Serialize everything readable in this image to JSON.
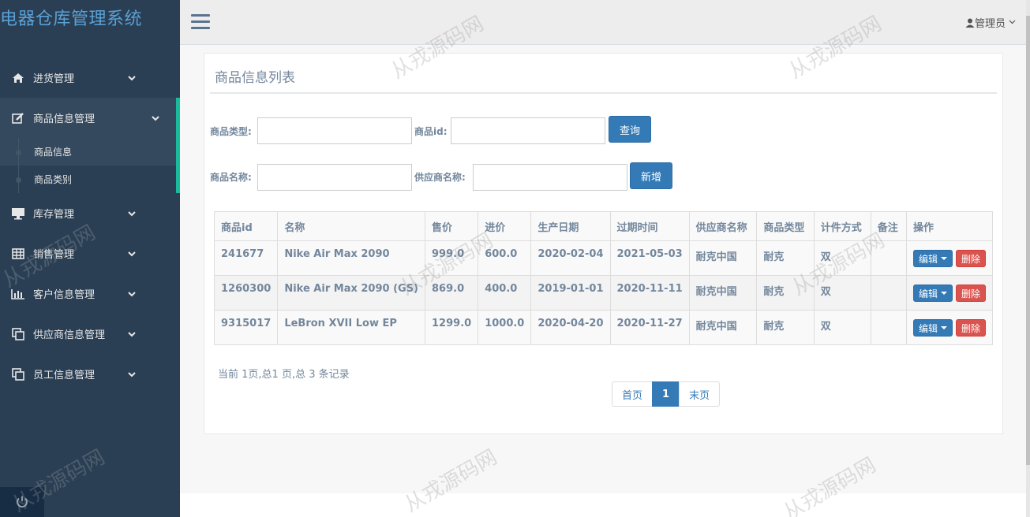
{
  "app": {
    "brand": "电器仓库管理系统"
  },
  "sidebar": {
    "items": [
      {
        "label": "进货管理",
        "icon": "home-icon"
      },
      {
        "label": "商品信息管理",
        "icon": "edit-icon"
      },
      {
        "label": "库存管理",
        "icon": "monitor-icon"
      },
      {
        "label": "销售管理",
        "icon": "table-icon"
      },
      {
        "label": "客户信息管理",
        "icon": "bar-chart-icon"
      },
      {
        "label": "供应商信息管理",
        "icon": "clone-icon"
      },
      {
        "label": "员工信息管理",
        "icon": "clone-icon"
      }
    ],
    "submenu": [
      {
        "label": "商品信息"
      },
      {
        "label": "商品类别"
      }
    ],
    "accent_color": "#1abb9c"
  },
  "topnav": {
    "user": "管理员"
  },
  "panel": {
    "title": "商品信息列表"
  },
  "filters": {
    "type_label": "商品类型:",
    "type_value": "",
    "id_label": "商品id:",
    "id_value": "",
    "query_button": "查询",
    "name_label": "商品名称:",
    "name_value": "",
    "supplier_label": "供应商名称:",
    "supplier_value": "",
    "add_button": "新增"
  },
  "table": {
    "headers": [
      "商品id",
      "名称",
      "售价",
      "进价",
      "生产日期",
      "过期时间",
      "供应商名称",
      "商品类型",
      "计件方式",
      "备注",
      "操作"
    ],
    "rows": [
      [
        "241677",
        "Nike Air Max 2090",
        "999.0",
        "600.0",
        "2020-02-04",
        "2021-05-03",
        "耐克中国",
        "耐克",
        "双",
        ""
      ],
      [
        "1260300",
        "Nike Air Max 2090 (GS)",
        "869.0",
        "400.0",
        "2019-01-01",
        "2020-11-11",
        "耐克中国",
        "耐克",
        "双",
        ""
      ],
      [
        "9315017",
        "LeBron XVII Low EP",
        "1299.0",
        "1000.0",
        "2020-04-20",
        "2020-11-27",
        "耐克中国",
        "耐克",
        "双",
        ""
      ]
    ],
    "edit_label": "编辑",
    "delete_label": "删除"
  },
  "summary": "当前 1页,总1 页,总 3 条记录",
  "pager": {
    "first": "首页",
    "current": "1",
    "last": "末页"
  },
  "watermark": "从戎源码网",
  "colors": {
    "primary": "#337ab7",
    "danger": "#d9534f",
    "sidebar_bg": "#2a3f54"
  }
}
